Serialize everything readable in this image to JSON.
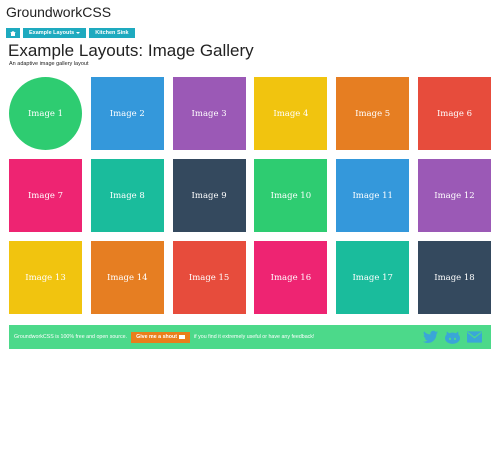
{
  "site": {
    "title": "GroundworkCSS"
  },
  "nav": {
    "items": [
      {
        "label": ""
      },
      {
        "label": "Example Layouts"
      },
      {
        "label": "Kitchen Sink"
      }
    ]
  },
  "page": {
    "title": "Example Layouts: Image Gallery",
    "subtitle": "An adaptive image gallery layout"
  },
  "gallery": {
    "images": [
      {
        "label": "Image 1",
        "color": "#2ecc71"
      },
      {
        "label": "Image 2",
        "color": "#3498db"
      },
      {
        "label": "Image 3",
        "color": "#9b59b6"
      },
      {
        "label": "Image 4",
        "color": "#f1c40f"
      },
      {
        "label": "Image 5",
        "color": "#e67e22"
      },
      {
        "label": "Image 6",
        "color": "#e74c3c"
      },
      {
        "label": "Image 7",
        "color": "#ee2472"
      },
      {
        "label": "Image 8",
        "color": "#1abc9c"
      },
      {
        "label": "Image 9",
        "color": "#34495e"
      },
      {
        "label": "Image 10",
        "color": "#2ecc71"
      },
      {
        "label": "Image 11",
        "color": "#3498db"
      },
      {
        "label": "Image 12",
        "color": "#9b59b6"
      },
      {
        "label": "Image 13",
        "color": "#f1c40f"
      },
      {
        "label": "Image 14",
        "color": "#e67e22"
      },
      {
        "label": "Image 15",
        "color": "#e74c3c"
      },
      {
        "label": "Image 16",
        "color": "#ee2472"
      },
      {
        "label": "Image 17",
        "color": "#1abc9c"
      },
      {
        "label": "Image 18",
        "color": "#34495e"
      }
    ]
  },
  "footer": {
    "text_before": "GroundworkCSS is 100% free and open source.",
    "button_label": "Give me a shout",
    "text_after": "if you find it extremely useful or have any feedback!",
    "icons": [
      "twitter-icon",
      "github-icon",
      "envelope-icon"
    ],
    "icon_color": "#3aa6d8"
  },
  "colors": {
    "nav_bg": "#1eaabf",
    "footer_bg": "#4cd98a",
    "shout_bg": "#e97f1b"
  }
}
